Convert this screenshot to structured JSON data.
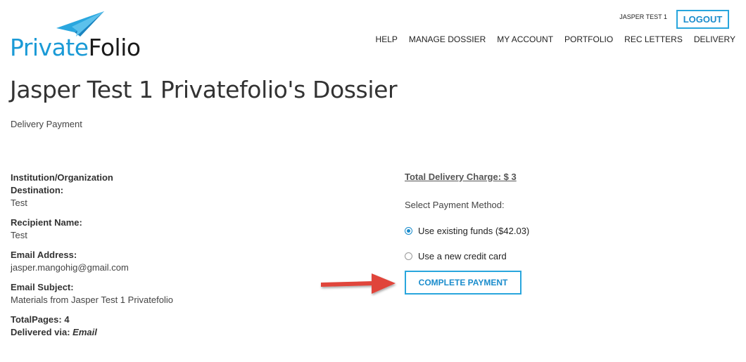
{
  "brand": {
    "name_part1": "Private",
    "name_part2": "Folio",
    "color_primary": "#1a9ad6"
  },
  "header": {
    "user_name": "JASPER TEST 1",
    "logout_label": "LOGOUT",
    "nav": [
      "HELP",
      "MANAGE DOSSIER",
      "MY ACCOUNT",
      "PORTFOLIO",
      "REC LETTERS",
      "DELIVERY"
    ]
  },
  "page": {
    "title": "Jasper Test 1 Privatefolio's Dossier",
    "subtitle": "Delivery Payment"
  },
  "details": {
    "institution_label": "Institution/Organization Destination:",
    "institution_value": "Test",
    "recipient_label": "Recipient Name:",
    "recipient_value": "Test",
    "email_label": "Email Address:",
    "email_value": "jasper.mangohig@gmail.com",
    "subject_label": "Email Subject:",
    "subject_value": "Materials from Jasper Test 1 Privatefolio",
    "pages_label": "TotalPages: 4",
    "delivered_label": "Delivered via:",
    "delivered_value": "Email"
  },
  "payment": {
    "total": "Total Delivery Charge: $ 3",
    "select_label": "Select Payment Method:",
    "option_existing": "Use existing funds ($42.03)",
    "option_new_card": "Use a new credit card",
    "selected": "existing",
    "complete_label": "COMPLETE PAYMENT"
  },
  "colors": {
    "accent": "#29a6dd",
    "arrow": "#e0453a"
  }
}
